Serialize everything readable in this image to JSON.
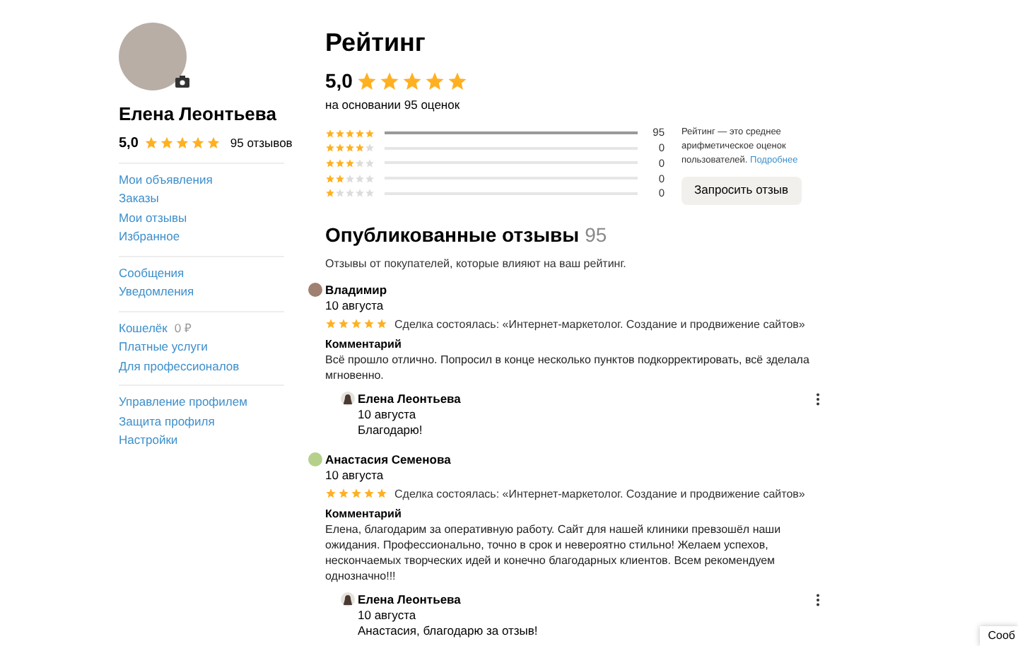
{
  "profile": {
    "name": "Елена Леонтьева",
    "score": "5,0",
    "stars": 5,
    "reviews": "95 отзывов"
  },
  "sidebar": {
    "groups": [
      [
        {
          "label": "Мои объявления"
        },
        {
          "label": "Заказы"
        },
        {
          "label": "Мои отзывы"
        },
        {
          "label": "Избранное"
        }
      ],
      [
        {
          "label": "Сообщения"
        },
        {
          "label": "Уведомления"
        }
      ],
      [
        {
          "label": "Кошелёк",
          "value": "0 ₽"
        },
        {
          "label": "Платные услуги"
        },
        {
          "label": "Для профессионалов"
        }
      ],
      [
        {
          "label": "Управление профилем"
        },
        {
          "label": "Защита профиля"
        },
        {
          "label": "Настройки"
        }
      ]
    ]
  },
  "rating": {
    "title": "Рейтинг",
    "score": "5,0",
    "stars": 5,
    "subtitle": "на основании 95 оценок",
    "distribution": [
      {
        "stars": 5,
        "level": 1,
        "count": "95"
      },
      {
        "stars": 4,
        "level": 0,
        "count": "0"
      },
      {
        "stars": 3,
        "level": 0,
        "count": "0"
      },
      {
        "stars": 2,
        "level": 0,
        "count": "0"
      },
      {
        "stars": 1,
        "level": 0,
        "count": "0"
      }
    ],
    "note": "Рейтинг — это среднее арифметическое оценок пользователей.",
    "note_link": "Подробнее",
    "button": "Запросить отзыв"
  },
  "reviews": {
    "title": "Опубликованные отзывы",
    "count": "95",
    "subtitle": "Отзывы от покупателей, которые влияют на ваш рейтинг.",
    "items": [
      {
        "author": "Владимир",
        "color": "#a08070",
        "date": "10 августа",
        "stars": 5,
        "deal": "Сделка состоялась: «Интернет-маркетолог. Создание и продвижение сайтов»",
        "comment_label": "Комментарий",
        "comment": "Всё прошло отлично. Попросил в конце несколько пунктов подкорректировать, всё зделала мгновенно.",
        "reply": {
          "author": "Елена Леонтьева",
          "date": "10 августа",
          "text": "Благодарю!"
        }
      },
      {
        "author": "Анастасия Семенова",
        "color": "#b5d08a",
        "date": "10 августа",
        "stars": 5,
        "deal": "Сделка состоялась: «Интернет-маркетолог. Создание и продвижение сайтов»",
        "comment_label": "Комментарий",
        "comment": "Елена, благодарим за оперативную работу. Сайт для нашей клиники превзошёл наши ожидания. Профессионально, точно в срок и невероятно стильно! Желаем успехов, нескончаемых творческих идей и конечно благодарных клиентов. Всем рекомендуем однозначно!!!",
        "reply": {
          "author": "Елена Леонтьева",
          "date": "10 августа",
          "text": "Анастасия, благодарю за отзыв!"
        }
      }
    ]
  },
  "chat_tab": "Сооб"
}
